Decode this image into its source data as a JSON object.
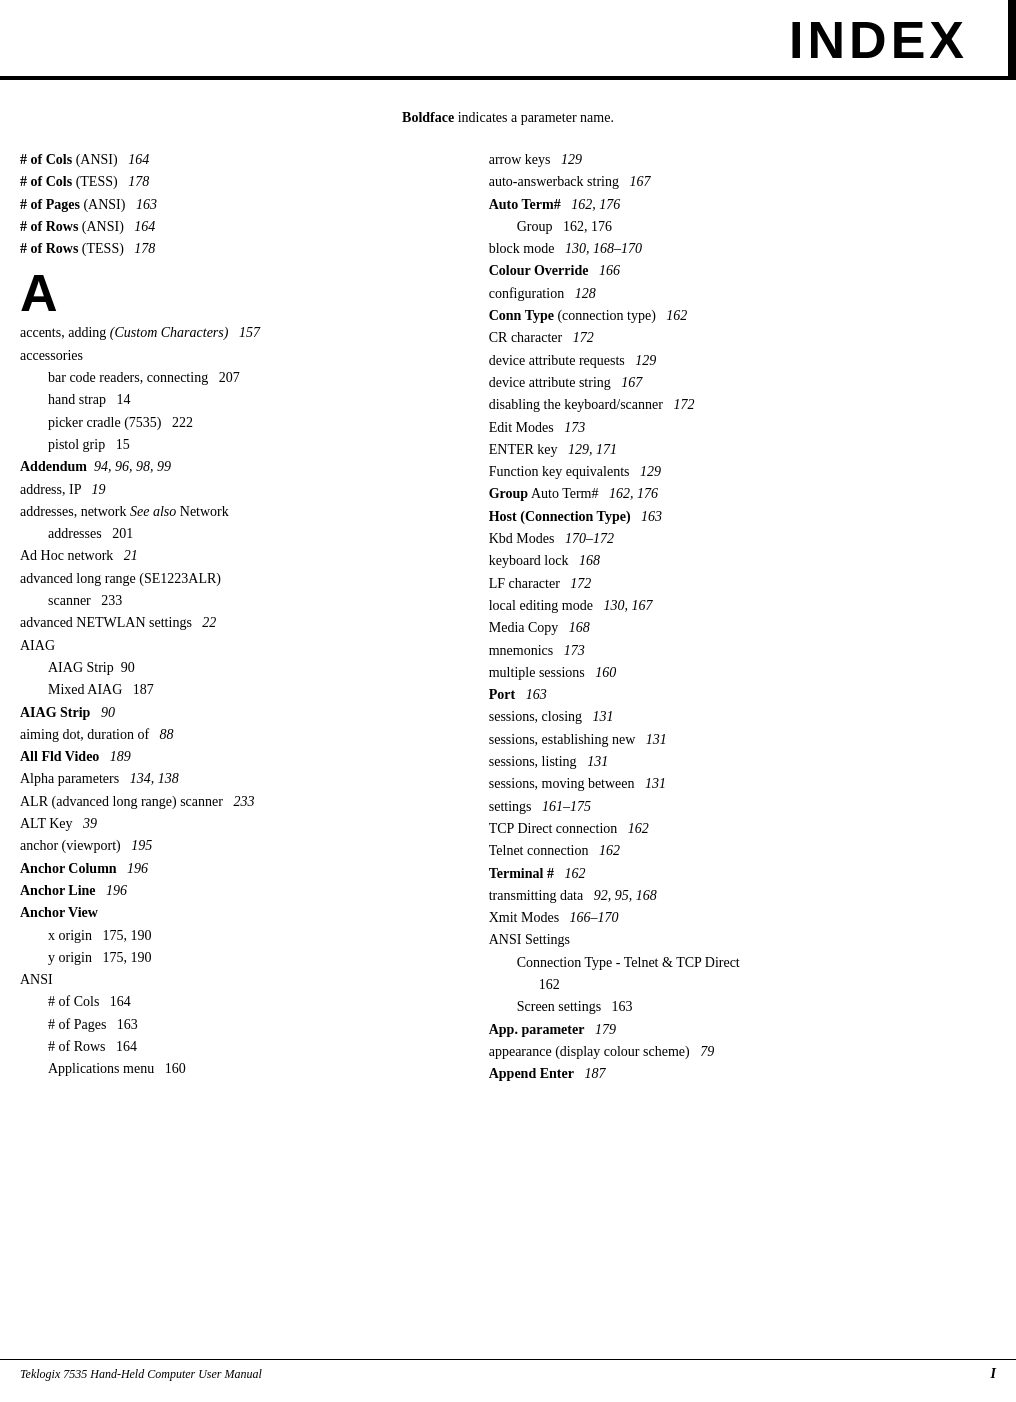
{
  "header": {
    "title": "Index",
    "display": "INDEX"
  },
  "intro": {
    "text_bold": "Boldface",
    "text_rest": " indicates a parameter name."
  },
  "left_column": [
    {
      "type": "entry",
      "text": "# of Cols",
      "bold": "# of Cols",
      "suffix": " (ANSI)   ",
      "pagenum": "164"
    },
    {
      "type": "entry",
      "text": "# of Cols",
      "bold": "# of Cols",
      "suffix": " (TESS)   ",
      "pagenum": "178"
    },
    {
      "type": "entry",
      "text": "# of Pages",
      "bold": "# of Pages",
      "suffix": " (ANSI)   ",
      "pagenum": "163"
    },
    {
      "type": "entry",
      "text": "# of Rows",
      "bold": "# of Rows",
      "suffix": " (ANSI)   ",
      "pagenum": "164"
    },
    {
      "type": "entry",
      "text": "# of Rows",
      "bold": "# of Rows",
      "suffix": " (TESS)   ",
      "pagenum": "178"
    },
    {
      "type": "letter",
      "text": "A"
    },
    {
      "type": "entry",
      "prefix": "accents, adding ",
      "italic": "(Custom Characters)",
      "suffix": "   ",
      "pagenum": "157"
    },
    {
      "type": "entry",
      "text": "accessories"
    },
    {
      "type": "sub",
      "text": "bar code readers, connecting   ",
      "pagenum": "207"
    },
    {
      "type": "sub",
      "text": "hand strap   ",
      "pagenum": "14"
    },
    {
      "type": "sub",
      "text": "picker cradle (7535)   ",
      "pagenum": "222"
    },
    {
      "type": "sub",
      "text": "pistol grip   ",
      "pagenum": "15"
    },
    {
      "type": "entry",
      "bold": "Addendum",
      "suffix": "   ",
      "pagenum": "94, 96, 98, 99"
    },
    {
      "type": "entry",
      "text": "address, IP   ",
      "pagenum": "19"
    },
    {
      "type": "entry",
      "text": "addresses, network ",
      "italic_part": "See also",
      "suffix2": " Network"
    },
    {
      "type": "sub",
      "text": "addresses   ",
      "pagenum": "201"
    },
    {
      "type": "entry",
      "text": "Ad Hoc network   ",
      "pagenum": "21"
    },
    {
      "type": "entry",
      "text": "advanced long range (SE1223ALR)"
    },
    {
      "type": "sub",
      "text": "scanner   ",
      "pagenum": "233"
    },
    {
      "type": "entry",
      "text": "advanced NETWLAN settings   ",
      "pagenum": "22"
    },
    {
      "type": "entry",
      "text": "AIAG"
    },
    {
      "type": "sub",
      "bold": "AIAG Strip",
      "suffix": "   ",
      "pagenum": "90"
    },
    {
      "type": "sub",
      "bold": "Mixed AIAG",
      "suffix": "   ",
      "pagenum": "187"
    },
    {
      "type": "entry",
      "bold": "AIAG Strip",
      "suffix": "   ",
      "pagenum": "90"
    },
    {
      "type": "entry",
      "text": "aiming dot, duration of   ",
      "pagenum": "88"
    },
    {
      "type": "entry",
      "bold": "All Fld Video",
      "suffix": "   ",
      "pagenum": "189"
    },
    {
      "type": "entry",
      "text": "Alpha parameters   ",
      "pagenum": "134, 138"
    },
    {
      "type": "entry",
      "text": "ALR (advanced long range) scanner   ",
      "pagenum": "233"
    },
    {
      "type": "entry",
      "text": "ALT Key   ",
      "pagenum": "39"
    },
    {
      "type": "entry",
      "text": "anchor (viewport)   ",
      "pagenum": "195"
    },
    {
      "type": "entry",
      "bold": "Anchor Column",
      "suffix": "   ",
      "pagenum": "196"
    },
    {
      "type": "entry",
      "bold": "Anchor Line",
      "suffix": "   ",
      "pagenum": "196"
    },
    {
      "type": "entry",
      "bold": "Anchor View"
    },
    {
      "type": "sub",
      "text": "x origin   ",
      "pagenum": "175, 190"
    },
    {
      "type": "sub",
      "text": "y origin   ",
      "pagenum": "175, 190"
    },
    {
      "type": "entry",
      "text": "ANSI"
    },
    {
      "type": "sub",
      "bold": "# of Cols",
      "suffix": "   ",
      "pagenum": "164"
    },
    {
      "type": "sub",
      "bold": "# of Pages",
      "suffix": "   ",
      "pagenum": "163"
    },
    {
      "type": "sub",
      "bold": "# of Rows",
      "suffix": "   ",
      "pagenum": "164"
    },
    {
      "type": "sub",
      "text": "Applications menu   ",
      "pagenum": "160"
    }
  ],
  "right_column": [
    {
      "type": "entry",
      "text": "arrow keys   ",
      "pagenum": "129"
    },
    {
      "type": "entry",
      "text": "auto-answerback string   ",
      "pagenum": "167"
    },
    {
      "type": "entry",
      "bold": "Auto Term#",
      "suffix": "   ",
      "pagenum": "162, 176"
    },
    {
      "type": "sub",
      "bold": "Group",
      "suffix": "   ",
      "pagenum": "162, 176"
    },
    {
      "type": "entry",
      "text": "block mode   ",
      "pagenum": "130, 168–170"
    },
    {
      "type": "entry",
      "bold": "Colour Override",
      "suffix": "   ",
      "pagenum": "166"
    },
    {
      "type": "entry",
      "text": "configuration   ",
      "pagenum": "128"
    },
    {
      "type": "entry",
      "bold": "Conn Type",
      "suffix": " (connection type)   ",
      "pagenum": "162"
    },
    {
      "type": "entry",
      "text": "CR character   ",
      "pagenum": "172"
    },
    {
      "type": "entry",
      "text": "device attribute requests   ",
      "pagenum": "129"
    },
    {
      "type": "entry",
      "text": "device attribute string   ",
      "pagenum": "167"
    },
    {
      "type": "entry",
      "text": "disabling the keyboard/scanner   ",
      "pagenum": "172"
    },
    {
      "type": "entry",
      "text": "Edit Modes   ",
      "pagenum": "173"
    },
    {
      "type": "entry",
      "text": "ENTER key   ",
      "pagenum": "129, 171"
    },
    {
      "type": "entry",
      "text": "Function key equivalents   ",
      "pagenum": "129"
    },
    {
      "type": "entry",
      "bold": "Group",
      "suffix": " Auto Term#   ",
      "pagenum": "162, 176"
    },
    {
      "type": "entry",
      "bold": "Host (Connection Type)",
      "suffix": "   ",
      "pagenum": "163"
    },
    {
      "type": "entry",
      "text": "Kbd Modes   ",
      "pagenum": "170–172"
    },
    {
      "type": "entry",
      "text": "keyboard lock   ",
      "pagenum": "168"
    },
    {
      "type": "entry",
      "text": "LF character   ",
      "pagenum": "172"
    },
    {
      "type": "entry",
      "text": "local editing mode   ",
      "pagenum": "130, 167"
    },
    {
      "type": "entry",
      "text": "Media Copy   ",
      "pagenum": "168"
    },
    {
      "type": "entry",
      "text": "mnemonics   ",
      "pagenum": "173"
    },
    {
      "type": "entry",
      "text": "multiple sessions   ",
      "pagenum": "160"
    },
    {
      "type": "entry",
      "bold": "Port",
      "suffix": "   ",
      "pagenum": "163"
    },
    {
      "type": "entry",
      "text": "sessions, closing   ",
      "pagenum": "131"
    },
    {
      "type": "entry",
      "text": "sessions, establishing new   ",
      "pagenum": "131"
    },
    {
      "type": "entry",
      "text": "sessions, listing   ",
      "pagenum": "131"
    },
    {
      "type": "entry",
      "text": "sessions, moving between   ",
      "pagenum": "131"
    },
    {
      "type": "entry",
      "text": "settings   ",
      "pagenum": "161–175"
    },
    {
      "type": "entry",
      "text": "TCP Direct connection   ",
      "pagenum": "162"
    },
    {
      "type": "entry",
      "text": "Telnet connection   ",
      "pagenum": "162"
    },
    {
      "type": "entry",
      "bold": "Terminal #",
      "suffix": "   ",
      "pagenum": "162"
    },
    {
      "type": "entry",
      "text": "transmitting data   ",
      "pagenum": "92, 95, 168"
    },
    {
      "type": "entry",
      "text": "Xmit Modes   ",
      "pagenum": "166–170"
    },
    {
      "type": "entry",
      "text": "ANSI Settings"
    },
    {
      "type": "sub",
      "text": "Connection Type - Telnet & TCP Direct   "
    },
    {
      "type": "sub2",
      "text": "162"
    },
    {
      "type": "sub",
      "text": "Screen settings   ",
      "pagenum": "163"
    },
    {
      "type": "entry",
      "bold": "App. parameter",
      "suffix": "   ",
      "pagenum": "179"
    },
    {
      "type": "entry",
      "text": "appearance (display colour scheme)   ",
      "pagenum": "79"
    },
    {
      "type": "entry",
      "bold": "Append Enter",
      "suffix": "   ",
      "pagenum": "187"
    }
  ],
  "footer": {
    "left": "Teklogix 7535 Hand-Held Computer User Manual",
    "right": "I"
  }
}
